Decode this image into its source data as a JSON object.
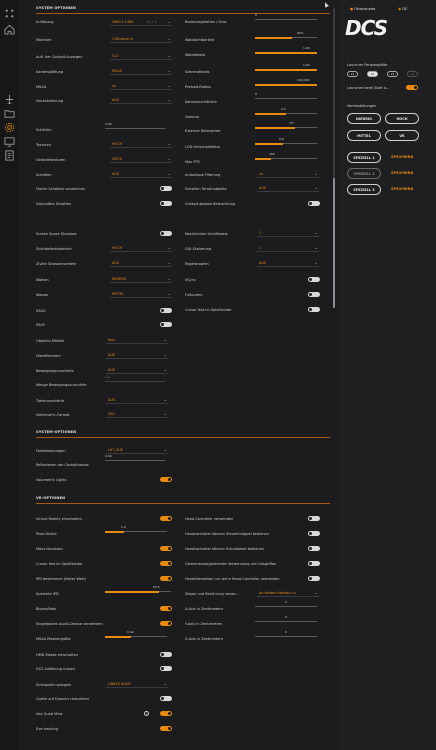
{
  "app": {
    "brand": "DCS"
  },
  "sidebar": {
    "icons": [
      "home-icon",
      "dots-icon",
      "plane-icon",
      "folder-icon",
      "gear-icon",
      "display-icon",
      "controller-icon",
      "file-icon"
    ]
  },
  "sections": {
    "system": "SYSTEM OPTIONEN",
    "system_lower": "SYSTEM-OPTIONEN",
    "vr": "VR-OPTIONEN"
  },
  "left_col": {
    "aufloesung": {
      "label": "Auflösung",
      "value": "2840 x 2160",
      "hint": "16 x 9"
    },
    "monitore": {
      "label": "Monitore",
      "value": "1 Bildschirm"
    },
    "cockpit_res": {
      "label": "Aufl. der Cockpit-Anzeigen",
      "value": "512"
    },
    "kanten": {
      "label": "Kantenglättung",
      "value": "MSAA"
    },
    "msaa": {
      "label": "MSAA",
      "value": "4x"
    },
    "hoch": {
      "label": "Hochskalierung",
      "value": "AUS"
    },
    "schaerfe": {
      "label": "Schärfen",
      "value": "0,00"
    },
    "texturen": {
      "label": "Texturen",
      "value": "HOCH"
    },
    "gelaende": {
      "label": "Geländetexturen",
      "value": "HOCH"
    },
    "schatten": {
      "label": "Schatten",
      "value": "AUS"
    },
    "flache": {
      "label": "Flache Schatten verwischen",
      "on": false
    },
    "sekundaer": {
      "label": "Sekundäre Schatten",
      "on": false
    },
    "screenspace": {
      "label": "Screen Space Shadows",
      "on": false
    },
    "sicht": {
      "label": "Sichtbarkeitsbereich",
      "value": "HOCH"
    },
    "ziviler": {
      "label": "Ziviler Strassenverkehr",
      "value": "AUS"
    },
    "wolken": {
      "label": "Wolken",
      "value": "NIEDRIG"
    },
    "wasser": {
      "label": "Wasser",
      "value": "MITTEL"
    },
    "ssao": {
      "label": "SSAO",
      "on": false
    },
    "sslr": {
      "label": "SSLR",
      "on": false
    },
    "objektiv": {
      "label": "Objektiv-Effekte",
      "value": "Kein"
    },
    "hitze": {
      "label": "Hitzeflimmern",
      "value": "AUS"
    },
    "bewegung": {
      "label": "Bewegungsunschärfe",
      "value": "AUS"
    },
    "menge_bewegung": {
      "label": "Menge Bewegungsunschärfe",
      "value": "1,0"
    },
    "tiefen": {
      "label": "Tiefenunschärfe",
      "value": "AUS"
    },
    "seiten": {
      "label": "Seitenverh.-Format",
      "value": "2X0"
    }
  },
  "right_col": {
    "bodenveg": {
      "label": "Bodenvegetation / Gras",
      "value": "0"
    },
    "waldsicht": {
      "label": "Waldsichtbarkeit",
      "value": "60%",
      "fraction": 0.6
    },
    "walddetails": {
      "label": "Walddetails",
      "value": "1,00",
      "fraction": 1.0
    },
    "szenen": {
      "label": "Szenendetails",
      "value": "1,00",
      "fraction": 1.0
    },
    "preload": {
      "label": "Preload-Radius",
      "value": "100.000",
      "fraction": 1.0
    },
    "kamin": {
      "label": "Kaminrauchdichte",
      "value": "0",
      "fraction": 0
    },
    "gamma": {
      "label": "Gamma",
      "value": "2,0",
      "fraction": 0.5
    },
    "externer": {
      "label": "Externer Blickwinkel",
      "value": "70°",
      "fraction": 0.65
    },
    "lod": {
      "label": "LOD-Umschaltfaktor",
      "value": "0,8",
      "fraction": 0.45
    },
    "maxfps": {
      "label": "Max FPS",
      "value": "180",
      "fraction": 0.25
    },
    "aniso": {
      "label": "Anisotrope Filterung",
      "value": "2x"
    },
    "terrain_shadows": {
      "label": "Schatten Terrainobjekte",
      "value": "AUS"
    },
    "cockpit_light": {
      "label": "Cockpit globale Beleuchtung",
      "on": false
    },
    "nachrichten": {
      "label": "Nachrichten Schriftskala",
      "value": "1"
    },
    "gui": {
      "label": "GUI-Skalierung",
      "value": "1"
    },
    "regen": {
      "label": "Regentropfen",
      "value": "AUS"
    },
    "vsync": {
      "label": "VSync",
      "on": false
    },
    "fullscreen": {
      "label": "Fullscreen",
      "on": false
    },
    "cursor_fest": {
      "label": "Cursor fest im Spielfenster",
      "on": false
    }
  },
  "lower": {
    "farb": {
      "label": "Farbabstufungen",
      "value": "LUT_AUE"
    },
    "reflex": {
      "label": "Reflexionen der Cockpithaube",
      "value": "0,00"
    },
    "volumetric": {
      "label": "Volumetric Lights",
      "on": true
    }
  },
  "vr": {
    "vr_on": {
      "label": "Virtual Reality einschalten",
      "on": true
    },
    "pixel": {
      "label": "Pixel-Dichte",
      "value": "1,0",
      "fraction": 0.3
    },
    "maus": {
      "label": "Maus benutzen",
      "on": true
    },
    "cursor_fest": {
      "label": "Cursor fest im Spielfenster",
      "on": true
    },
    "ipd_fest": {
      "label": "IPD bestimmen (fester Wert)",
      "on": true
    },
    "spezielle_ipd": {
      "label": "Spezielle IPD",
      "value": "63,5",
      "fraction": 0.82
    },
    "bloom": {
      "label": "Bloom/Netz",
      "on": true
    },
    "audio": {
      "label": "Eingebautes Audio-Device verwenden",
      "on": true
    },
    "msaa_mask": {
      "label": "MSAA Maskengröße",
      "value": "0,42",
      "fraction": 0.42
    },
    "hmd_mask": {
      "label": "HMD-Maske einschalten",
      "on": false
    },
    "dcs_aufl": {
      "label": "DCS Auflösung nutzen",
      "on": false
    },
    "sicht_spiegeln": {
      "label": "Sichtquelle spiegeln",
      "value": "LINKES AUGE"
    },
    "quelle": {
      "label": "Quelle auf Droocks reduzieren",
      "on": false
    },
    "quad": {
      "label": "Use Quad View",
      "on": true
    },
    "eye": {
      "label": "Eye tracking",
      "on": true
    },
    "hand_ctrl": {
      "label": "Hand-Controller verwenden",
      "on": false
    },
    "hand_steuer": {
      "label": "Handcontroller können Steuerknüppel bedienen",
      "on": false
    },
    "hand_schub": {
      "label": "Handcontroller können Schubhebel bedienen",
      "on": false
    },
    "gemeinsame": {
      "label": "Gemeinsame/getrennte Verwendung von Gasgriffen",
      "on": false
    },
    "handinter": {
      "label": "Handinteraktion nur wenn Hand-Controller vorhanden",
      "on": false
    },
    "zeiger": {
      "label": "Zeiger und Berührung verwe...",
      "value": "An beiden Händen nu"
    },
    "xachse": {
      "label": "X-Axis in Zentimetern",
      "value": "0"
    },
    "yachse": {
      "label": "Y-Axis in Zentimetern",
      "value": "0"
    },
    "zachse": {
      "label": "Z-Axis in Zentimetern",
      "value": "0"
    }
  },
  "panel": {
    "user": "Otrocanedo",
    "lang": "DE",
    "launcher_size": "Launcher Fenstergröße",
    "scales": [
      "x1",
      "x2",
      "x3",
      "x4"
    ],
    "launcher_start": "Launcher beim Start a...",
    "presets_title": "Voreinstellungen",
    "presets": [
      "NIEDRIG",
      "HOCH",
      "MITTEL",
      "VR"
    ],
    "specials": [
      "SPEZIELL 1",
      "SPEZIELL 2",
      "SPEZIELL 3"
    ],
    "save": "SPEICHERN"
  }
}
